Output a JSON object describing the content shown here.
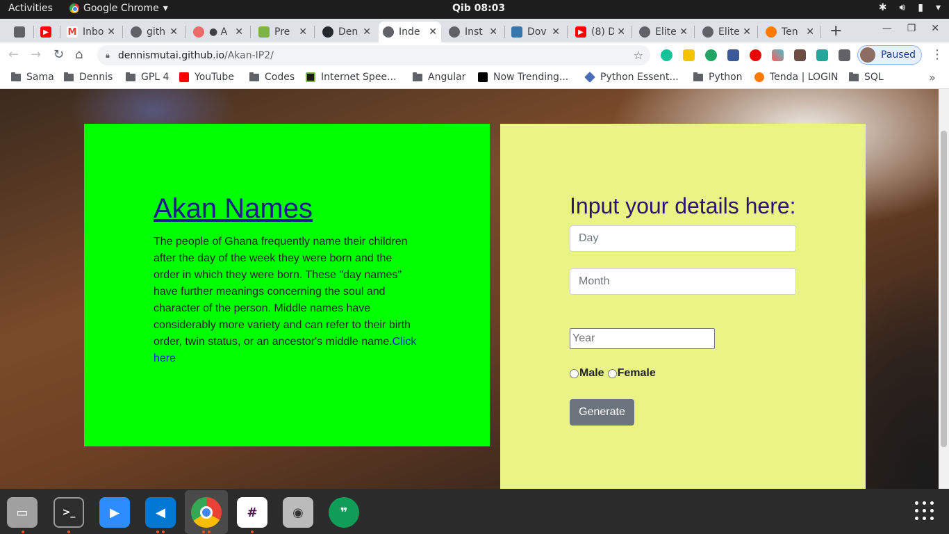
{
  "topbar": {
    "activities": "Activities",
    "app_name": "Google Chrome",
    "clock": "Qib 08:03"
  },
  "tabs": [
    {
      "title": "",
      "fav_color": "#5f6368"
    },
    {
      "title": "",
      "fav_color": "#ff0000"
    },
    {
      "title": "Inbo",
      "fav_color": "#ea4335"
    },
    {
      "title": "gith",
      "fav_color": "#5f6368"
    },
    {
      "title": "● A",
      "fav_color": "#f06a6a"
    },
    {
      "title": "Pre",
      "fav_color": "#7cb342"
    },
    {
      "title": "Den",
      "fav_color": "#24292e"
    },
    {
      "title": "Inde",
      "fav_color": "#5f6368"
    },
    {
      "title": "Inst",
      "fav_color": "#5f6368"
    },
    {
      "title": "Dov",
      "fav_color": "#3776ab"
    },
    {
      "title": "(8) D",
      "fav_color": "#ff0000"
    },
    {
      "title": "Elite",
      "fav_color": "#5f6368"
    },
    {
      "title": "Elite",
      "fav_color": "#5f6368"
    },
    {
      "title": "Ten",
      "fav_color": "#ff7a00"
    }
  ],
  "address": {
    "domain": "dennismutai.github.io",
    "path": "/Akan-IP2/"
  },
  "profile": {
    "label": "Paused"
  },
  "bookmarks": [
    {
      "label": "Sama",
      "type": "folder"
    },
    {
      "label": "Dennis",
      "type": "folder"
    },
    {
      "label": "GPL 4",
      "type": "folder"
    },
    {
      "label": "YouTube",
      "type": "site",
      "color": "#ff0000"
    },
    {
      "label": "Codes",
      "type": "folder"
    },
    {
      "label": "Internet Spee...",
      "type": "site",
      "color": "#1a1a1a"
    },
    {
      "label": "Angular",
      "type": "folder"
    },
    {
      "label": "Now Trending...",
      "type": "site",
      "color": "#000000"
    },
    {
      "label": "Python Essent...",
      "type": "site",
      "color": "#4b6cb7"
    },
    {
      "label": "Python",
      "type": "folder"
    },
    {
      "label": "Tenda | LOGIN",
      "type": "site",
      "color": "#ff7a00"
    },
    {
      "label": "SQL",
      "type": "folder"
    }
  ],
  "page": {
    "title": "Akan Names",
    "description": "The people of Ghana frequently name their children after the day of the week they were born and the order in which they were born. These \"day names\" have further meanings concerning the soul and character of the person. Middle names have considerably more variety and can refer to their birth order, twin status, or an ancestor's middle name.",
    "link": "Click here",
    "form_heading": "Input your details here:",
    "day_placeholder": "Day",
    "month_placeholder": "Month",
    "year_placeholder": "Year",
    "male_label": "Male",
    "female_label": "Female",
    "button_label": "Generate",
    "colors": {
      "left_panel": "#00ff00",
      "right_panel": "#eaf485",
      "heading": "#2c1272",
      "button": "#6c757d"
    }
  }
}
